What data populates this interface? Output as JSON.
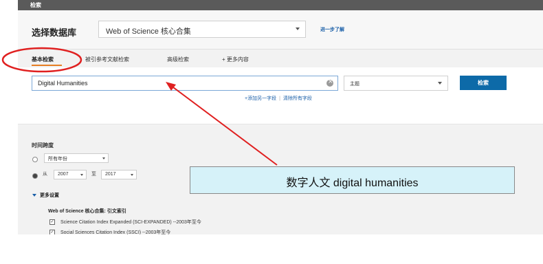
{
  "topbar": {
    "title": "检索"
  },
  "database": {
    "label": "选择数据库",
    "selected": "Web of Science 核心合集",
    "learn_more": "进一步了解"
  },
  "tabs": [
    {
      "label": "基本检索",
      "active": true
    },
    {
      "label": "被引参考文献检索"
    },
    {
      "label": "高级检索"
    },
    {
      "label": "+ 更多内容"
    }
  ],
  "search": {
    "query": "Digital Humanities",
    "field": "主题",
    "button": "检索",
    "add_field": "+添加另一字段",
    "clear_fields": "清除所有字段"
  },
  "timespan": {
    "label": "时间跨度",
    "all_years": "所有年份",
    "from_label": "从",
    "from_year": "2007",
    "to_label": "至",
    "to_year": "2017"
  },
  "more_settings": {
    "label": "更多设置",
    "index_title": "Web of Science 核心合集: 引文索引",
    "indexes": [
      "Science Citation Index Expanded (SCI-EXPANDED) --2003年至今",
      "Social Sciences Citation Index (SSCI) --2003年至今"
    ]
  },
  "annotation": {
    "callout_text": "数字人文   digital humanities",
    "color": "#e02020"
  }
}
